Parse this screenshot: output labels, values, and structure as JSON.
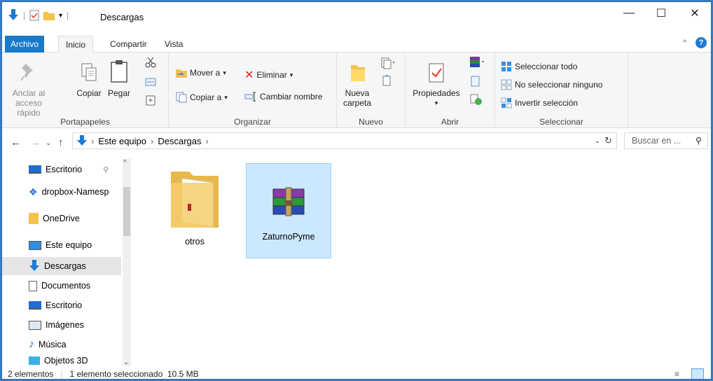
{
  "window": {
    "title": "Descargas",
    "controls": [
      "minimize",
      "maximize",
      "close"
    ]
  },
  "tabs": {
    "file": "Archivo",
    "home": "Inicio",
    "share": "Compartir",
    "view": "Vista"
  },
  "ribbon": {
    "clipboard": {
      "group_label": "Portapapeles",
      "pin_label_1": "Anclar al",
      "pin_label_2": "acceso rápido",
      "copy": "Copiar",
      "paste": "Pegar"
    },
    "organize": {
      "group_label": "Organizar",
      "move_to": "Mover a",
      "copy_to": "Copiar a",
      "delete": "Eliminar",
      "rename": "Cambiar nombre"
    },
    "new": {
      "group_label": "Nuevo",
      "new_folder_1": "Nueva",
      "new_folder_2": "carpeta"
    },
    "open": {
      "group_label": "Abrir",
      "properties": "Propiedades"
    },
    "select": {
      "group_label": "Seleccionar",
      "select_all": "Seleccionar todo",
      "select_none": "No seleccionar ninguno",
      "invert": "Invertir selección"
    }
  },
  "address": {
    "crumbs": [
      "Este equipo",
      "Descargas"
    ],
    "search_placeholder": "Buscar en ..."
  },
  "navpane": {
    "items": [
      {
        "label": "Escritorio",
        "icon": "desktop-icon"
      },
      {
        "label": "dropbox-Namesp",
        "icon": "dropbox-icon"
      },
      {
        "label": "OneDrive",
        "icon": "folder-icon"
      },
      {
        "label": "Este equipo",
        "icon": "computer-icon"
      },
      {
        "label": "Descargas",
        "icon": "download-icon"
      },
      {
        "label": "Documentos",
        "icon": "document-icon"
      },
      {
        "label": "Escritorio",
        "icon": "desktop-icon"
      },
      {
        "label": "Imágenes",
        "icon": "pictures-icon"
      },
      {
        "label": "Música",
        "icon": "music-icon"
      },
      {
        "label": "Objetos 3D",
        "icon": "3d-objects-icon"
      }
    ]
  },
  "files": [
    {
      "name": "otros",
      "icon": "folder-icon",
      "selected": false
    },
    {
      "name": "ZaturnoPyme",
      "icon": "winrar-archive-icon",
      "selected": true
    }
  ],
  "status": {
    "count": "2 elementos",
    "selection": "1 elemento seleccionado  10.5 MB"
  },
  "colors": {
    "accent": "#1979ca",
    "selection_bg": "#cce8ff",
    "selection_border": "#99d1ff"
  }
}
